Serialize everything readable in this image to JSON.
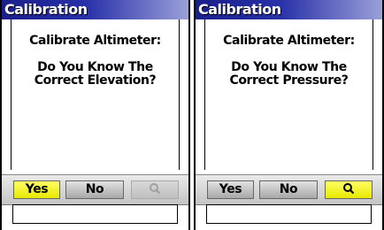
{
  "colors": {
    "title_bar": "#1a1f8a",
    "selected_button": "#ffff33",
    "normal_button": "#b4b4b4",
    "disabled_text": "#9a9a9a"
  },
  "screens": [
    {
      "title": "Calibration",
      "heading": "Calibrate Altimeter:",
      "question_line1": "Do You Know The",
      "question_line2": "Correct Elevation?",
      "buttons": {
        "yes": "Yes",
        "no": "No",
        "q_icon": "magnifier-icon"
      },
      "selected": "yes",
      "q_disabled": true
    },
    {
      "title": "Calibration",
      "heading": "Calibrate Altimeter:",
      "question_line1": "Do You Know The",
      "question_line2": "Correct Pressure?",
      "buttons": {
        "yes": "Yes",
        "no": "No",
        "q_icon": "magnifier-icon"
      },
      "selected": "q",
      "q_disabled": false
    }
  ]
}
